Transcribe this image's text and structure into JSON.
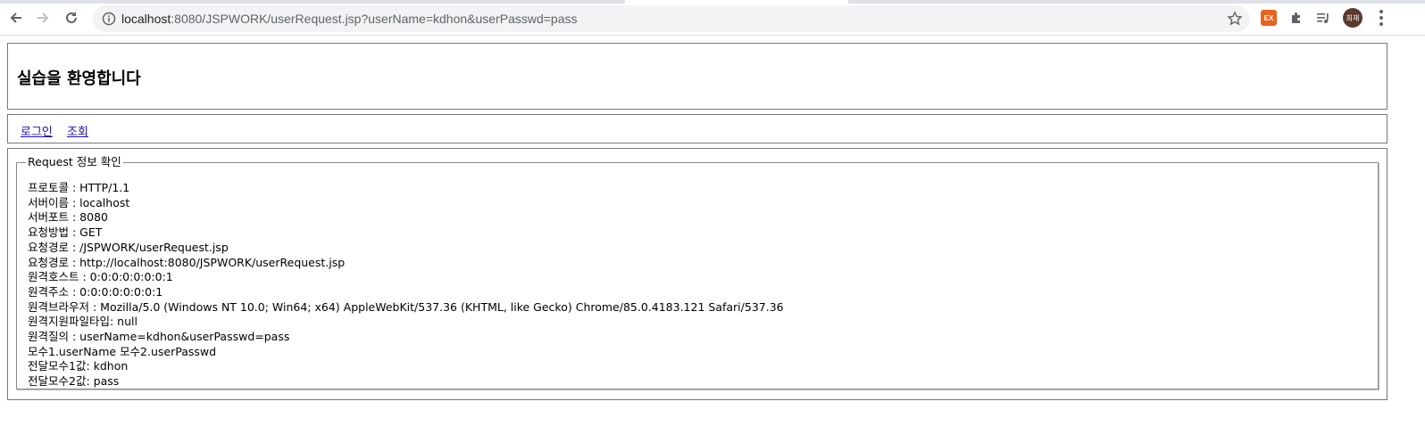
{
  "browser": {
    "url_host": "localhost",
    "url_rest": ":8080/JSPWORK/userRequest.jsp?userName=kdhon&userPasswd=pass",
    "extension_badge": "EX",
    "avatar_text": "희재",
    "icons": [
      "back-icon",
      "forward-icon",
      "reload-icon",
      "info-icon",
      "star-icon",
      "extensions-icon",
      "media-icon",
      "menu-icon"
    ]
  },
  "header": {
    "title": "실습을 환영합니다"
  },
  "nav": {
    "links": [
      "로그인",
      "조회"
    ]
  },
  "request_info": {
    "legend": "Request 정보 확인",
    "lines": [
      "프로토콜 : HTTP/1.1",
      "서버이름 : localhost",
      "서버포트 : 8080",
      "요청방법 : GET",
      "요청경로 : /JSPWORK/userRequest.jsp",
      "요청경로 : http://localhost:8080/JSPWORK/userRequest.jsp",
      "원격호스트 : 0:0:0:0:0:0:0:1",
      "원격주소 : 0:0:0:0:0:0:0:1",
      "원격브라우저 : Mozilla/5.0 (Windows NT 10.0; Win64; x64) AppleWebKit/537.36 (KHTML, like Gecko) Chrome/85.0.4183.121 Safari/537.36",
      "원격지원파일타입: null",
      "원격질의 : userName=kdhon&userPasswd=pass",
      "모수1.userName 모수2.userPasswd",
      "전달모수1값: kdhon",
      "전달모수2값: pass"
    ]
  },
  "colors": {
    "link": "#1a0dab",
    "border": "#777777",
    "omnibox_bg": "#f1f3f4",
    "extension_orange": "#e8631c"
  }
}
